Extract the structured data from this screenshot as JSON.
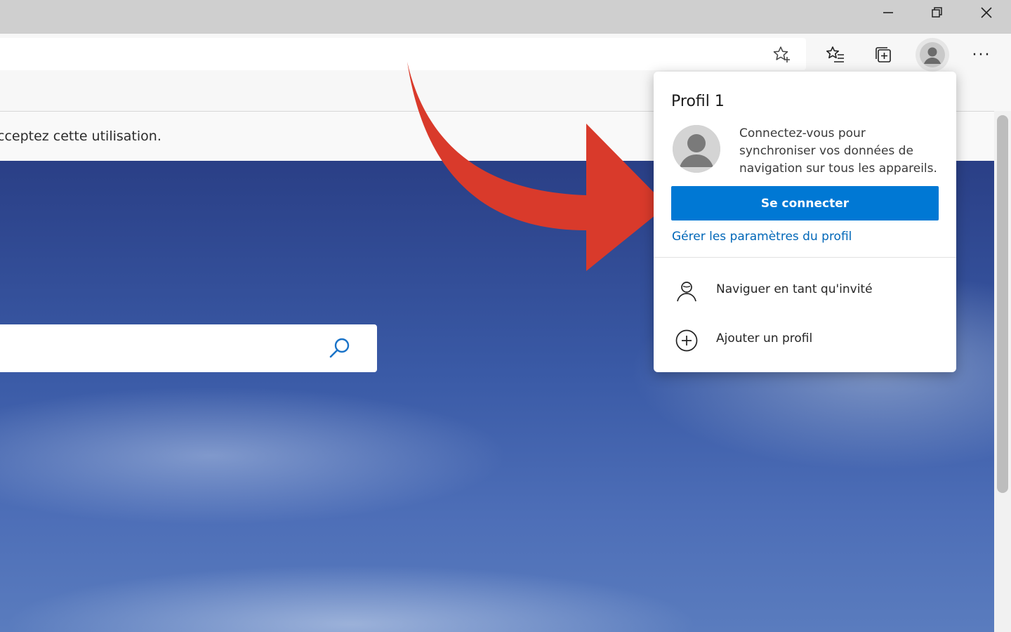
{
  "window": {
    "minimize_icon": "minimize-icon",
    "restore_icon": "restore-icon",
    "close_icon": "close-icon"
  },
  "toolbar": {
    "favorite_icon": "star-add-icon",
    "favorites_icon": "favorites-list-icon",
    "collections_icon": "collections-icon",
    "profile_icon": "avatar-icon",
    "more_icon": "ellipsis-icon",
    "more_label": "···"
  },
  "page": {
    "notice_text": "cceptez cette utilisation.",
    "search_icon": "search-icon"
  },
  "profile_flyout": {
    "title": "Profil 1",
    "description": "Connectez-vous pour synchroniser vos données de navigation sur tous les appareils.",
    "signin_label": "Se connecter",
    "manage_link": "Gérer les paramètres du profil",
    "menu_items": [
      {
        "label": "Naviguer en tant qu'invité",
        "icon": "guest-person-icon"
      },
      {
        "label": "Ajouter un profil",
        "icon": "add-circle-icon"
      }
    ]
  },
  "colors": {
    "accent": "#0078d4",
    "link": "#0067b8",
    "arrow": "#d93a2b"
  }
}
